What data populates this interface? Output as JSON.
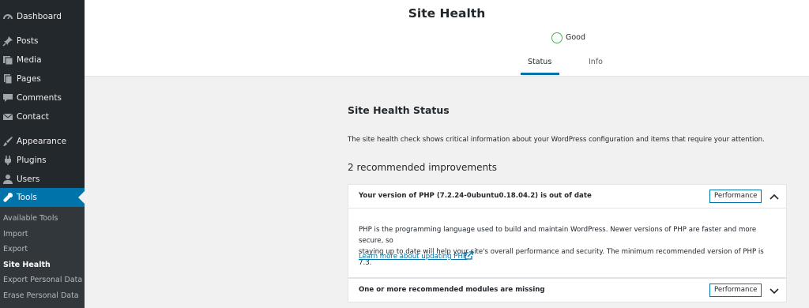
{
  "sidebar": {
    "items": [
      {
        "label": "Dashboard",
        "icon": "dashboard-icon"
      },
      {
        "label": "Posts",
        "icon": "pin-icon"
      },
      {
        "label": "Media",
        "icon": "media-icon"
      },
      {
        "label": "Pages",
        "icon": "pages-icon"
      },
      {
        "label": "Comments",
        "icon": "comments-icon"
      },
      {
        "label": "Contact",
        "icon": "mail-icon"
      },
      {
        "label": "Appearance",
        "icon": "brush-icon"
      },
      {
        "label": "Plugins",
        "icon": "plug-icon"
      },
      {
        "label": "Users",
        "icon": "user-icon"
      },
      {
        "label": "Tools",
        "icon": "wrench-icon"
      }
    ],
    "submenu": [
      "Available Tools",
      "Import",
      "Export",
      "Site Health",
      "Export Personal Data",
      "Erase Personal Data"
    ]
  },
  "header": {
    "title": "Site Health",
    "status": "Good",
    "tabs": [
      "Status",
      "Info"
    ]
  },
  "main": {
    "section_title": "Site Health Status",
    "description": "The site health check shows critical information about your WordPress configuration and items that require your attention.",
    "issues_count": "2 recommended improvements",
    "issues": [
      {
        "title": "Your version of PHP (7.2.24-0ubuntu0.18.04.2) is out of date",
        "badge": "Performance",
        "body_line1": "PHP is the programming language used to build and maintain WordPress. Newer versions of PHP are faster and more secure, so",
        "body_line2": "staying up to date will help your site's overall performance and security. The minimum recommended version of PHP is 7.3.",
        "link": "Learn more about updating PHP"
      },
      {
        "title": "One or more recommended modules are missing",
        "badge": "Performance"
      }
    ]
  },
  "colors": {
    "accent": "#0073aa",
    "good": "#46b450",
    "sidebar": "#23282d"
  }
}
